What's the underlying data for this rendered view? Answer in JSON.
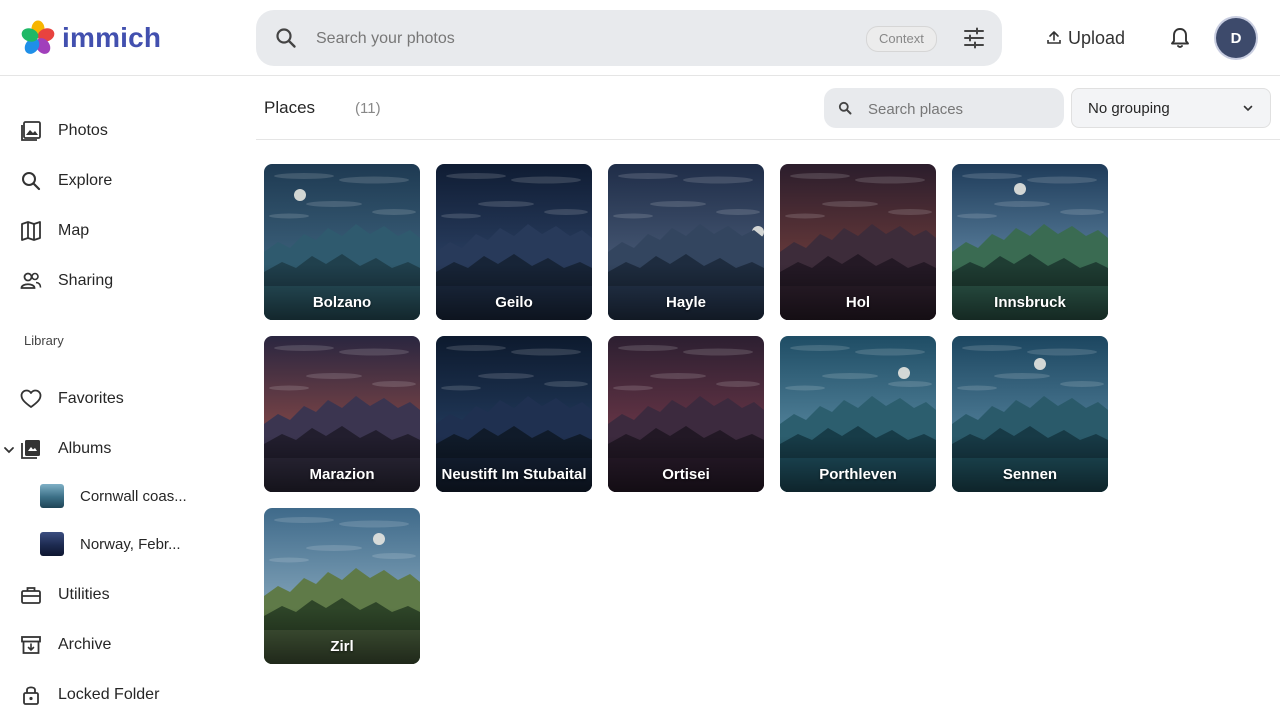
{
  "app": {
    "name": "immich"
  },
  "search": {
    "placeholder": "Search your photos",
    "context_label": "Context"
  },
  "header": {
    "upload_label": "Upload",
    "avatar_initial": "D"
  },
  "sidebar": {
    "items": [
      {
        "label": "Photos",
        "icon": "photos-icon"
      },
      {
        "label": "Explore",
        "icon": "search-icon"
      },
      {
        "label": "Map",
        "icon": "map-icon"
      },
      {
        "label": "Sharing",
        "icon": "people-icon"
      }
    ],
    "library_label": "Library",
    "library_items": [
      {
        "label": "Favorites",
        "icon": "heart-icon"
      },
      {
        "label": "Albums",
        "icon": "album-icon"
      }
    ],
    "albums": [
      {
        "label": "Cornwall coas...",
        "thumb": "#5b8ea6"
      },
      {
        "label": "Norway, Febr...",
        "thumb": "#26325e"
      }
    ],
    "bottom_items": [
      {
        "label": "Utilities",
        "icon": "toolbox-icon"
      },
      {
        "label": "Archive",
        "icon": "archive-icon"
      },
      {
        "label": "Locked Folder",
        "icon": "lock-icon"
      }
    ]
  },
  "places": {
    "title": "Places",
    "count": "(11)",
    "search_placeholder": "Search places",
    "grouping": "No grouping",
    "tiles": [
      {
        "name": "Bolzano",
        "sky": [
          "#1e3a52",
          "#4c7590"
        ],
        "far": "#2f5a6e",
        "near": "#20404d",
        "water": "#2a5562",
        "moon": true
      },
      {
        "name": "Geilo",
        "sky": [
          "#0f1c33",
          "#39527a"
        ],
        "far": "#283a5a",
        "near": "#172437",
        "water": "#1d2c44",
        "moon": false
      },
      {
        "name": "Hayle",
        "sky": [
          "#1f2d48",
          "#5b6f8b"
        ],
        "far": "#33455f",
        "near": "#1e2c3f",
        "water": "#263750",
        "moon": true
      },
      {
        "name": "Hol",
        "sky": [
          "#2b1d2c",
          "#8a4a42"
        ],
        "far": "#3d2c3a",
        "near": "#241925",
        "water": "#2d1f2c",
        "moon": false
      },
      {
        "name": "Innsbruck",
        "sky": [
          "#1f3c5a",
          "#79a3c0"
        ],
        "far": "#3a6b52",
        "near": "#1f3d33",
        "water": "#2e5a4c",
        "moon": true
      },
      {
        "name": "Marazion",
        "sky": [
          "#2a2640",
          "#b0584a"
        ],
        "far": "#3b3550",
        "near": "#221e2e",
        "water": "#2e2a3c",
        "moon": false
      },
      {
        "name": "Neustift Im Stubaital",
        "sky": [
          "#0d1a2e",
          "#2c4a72"
        ],
        "far": "#1f3050",
        "near": "#101b2a",
        "water": "#162338",
        "moon": false
      },
      {
        "name": "Ortisei",
        "sky": [
          "#2c1f31",
          "#8a4252"
        ],
        "far": "#3c2a3e",
        "near": "#221825",
        "water": "#2a1c2c",
        "moon": false
      },
      {
        "name": "Porthleven",
        "sky": [
          "#1f4d65",
          "#6fa0b8"
        ],
        "far": "#2c5e6e",
        "near": "#173c48",
        "water": "#1f5060",
        "moon": true
      },
      {
        "name": "Sennen",
        "sky": [
          "#1c4660",
          "#6c9cb6"
        ],
        "far": "#2a5a6a",
        "near": "#173a46",
        "water": "#1f4f5c",
        "moon": true
      },
      {
        "name": "Zirl",
        "sky": [
          "#3f6a8a",
          "#a6c2d2"
        ],
        "far": "#5f7a48",
        "near": "#2e4528",
        "water": "#465a3a",
        "moon": true
      }
    ]
  }
}
